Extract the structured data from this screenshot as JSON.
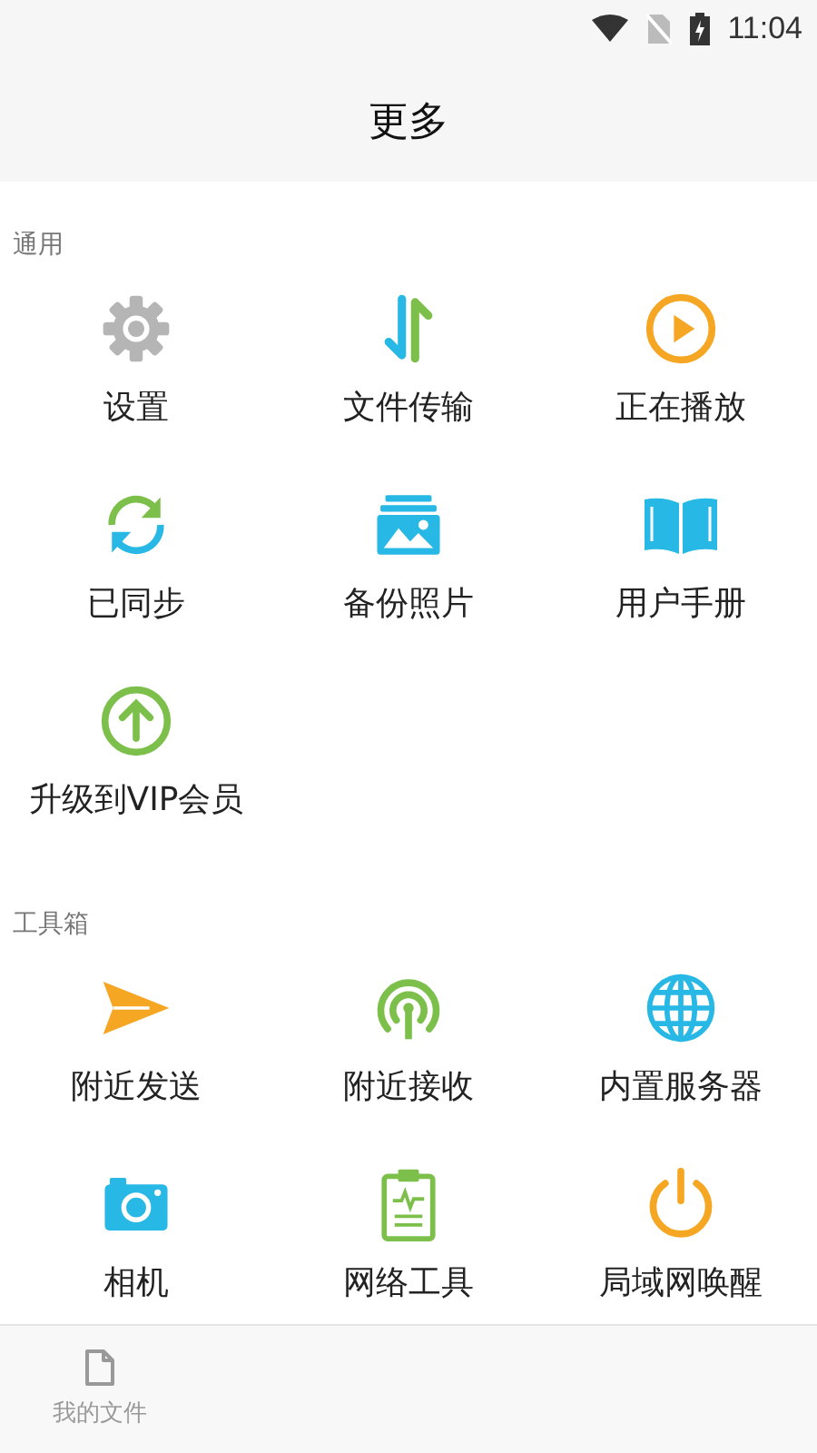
{
  "status_bar": {
    "time": "11:04"
  },
  "header": {
    "title": "更多"
  },
  "sections": [
    {
      "title": "通用",
      "items": [
        {
          "label": "设置",
          "kind": "gear"
        },
        {
          "label": "文件传输",
          "kind": "transfer"
        },
        {
          "label": "正在播放",
          "kind": "play"
        },
        {
          "label": "已同步",
          "kind": "sync"
        },
        {
          "label": "备份照片",
          "kind": "photos"
        },
        {
          "label": "用户手册",
          "kind": "book"
        },
        {
          "label": "升级到VIP会员",
          "kind": "upgrade"
        }
      ]
    },
    {
      "title": "工具箱",
      "items": [
        {
          "label": "附近发送",
          "kind": "send"
        },
        {
          "label": "附近接收",
          "kind": "receive"
        },
        {
          "label": "内置服务器",
          "kind": "globe"
        },
        {
          "label": "相机",
          "kind": "camera"
        },
        {
          "label": "网络工具",
          "kind": "clipboard"
        },
        {
          "label": "局域网唤醒",
          "kind": "power"
        }
      ]
    }
  ],
  "bottom_nav": [
    {
      "label": "我的文件",
      "selected": false
    }
  ]
}
